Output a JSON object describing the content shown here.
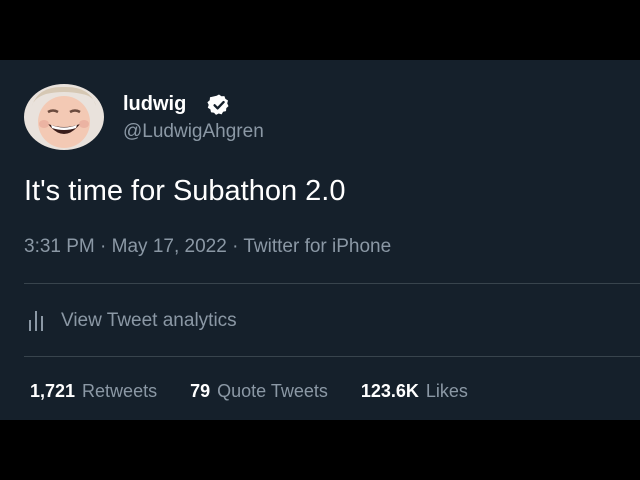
{
  "tweet": {
    "author": {
      "display_name": "ludwig",
      "handle": "@LudwigAhgren",
      "verified_icon": "verified-badge-icon"
    },
    "text": "It's time for Subathon 2.0",
    "meta": {
      "time": "3:31 PM",
      "date": "May 17, 2022",
      "source": "Twitter for iPhone",
      "separator": "·"
    },
    "analytics_label": "View Tweet analytics",
    "stats": [
      {
        "count": "1,721",
        "label": "Retweets"
      },
      {
        "count": "79",
        "label": "Quote Tweets"
      },
      {
        "count": "123.6K",
        "label": "Likes"
      }
    ]
  },
  "colors": {
    "background": "#15202b",
    "primary_text": "#ffffff",
    "secondary_text": "#8b98a5",
    "divider": "#38444d",
    "letterbox": "#000000"
  }
}
